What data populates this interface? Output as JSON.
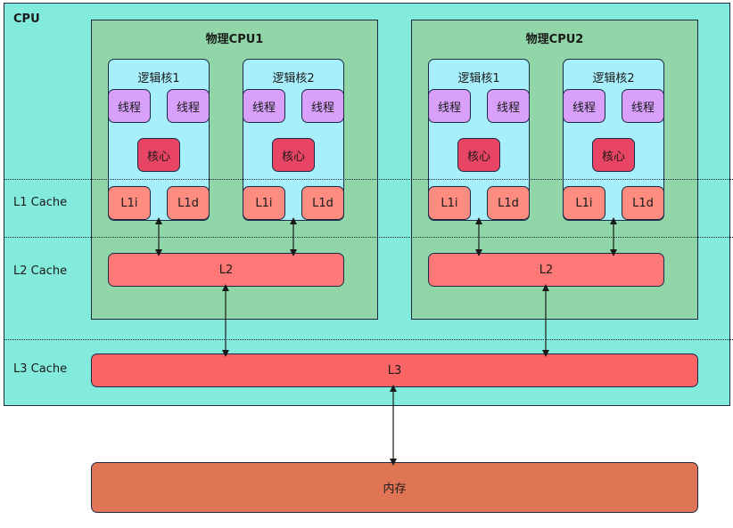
{
  "cpu": {
    "title": "CPU"
  },
  "levels": {
    "l1": "L1 Cache",
    "l2": "L2 Cache",
    "l3": "L3 Cache"
  },
  "physical_cpus": [
    {
      "title": "物理CPU1",
      "cores": [
        {
          "title": "逻辑核1",
          "threads": [
            "线程",
            "线程"
          ],
          "kernel": "核心",
          "l1i": "L1i",
          "l1d": "L1d"
        },
        {
          "title": "逻辑核2",
          "threads": [
            "线程",
            "线程"
          ],
          "kernel": "核心",
          "l1i": "L1i",
          "l1d": "L1d"
        }
      ],
      "l2": "L2"
    },
    {
      "title": "物理CPU2",
      "cores": [
        {
          "title": "逻辑核1",
          "threads": [
            "线程",
            "线程"
          ],
          "kernel": "核心",
          "l1i": "L1i",
          "l1d": "L1d"
        },
        {
          "title": "逻辑核2",
          "threads": [
            "线程",
            "线程"
          ],
          "kernel": "核心",
          "l1i": "L1i",
          "l1d": "L1d"
        }
      ],
      "l2": "L2"
    }
  ],
  "l3": "L3",
  "memory": "内存",
  "colors": {
    "cpu": "#83ebdc",
    "physical": "#90d6a8",
    "core": "#a8effc",
    "thread": "#d9a0fb",
    "kernel": "#e84463",
    "l1": "#ff8c80",
    "l2": "#ff7878",
    "l3": "#fa6464",
    "memory": "#e07555"
  }
}
